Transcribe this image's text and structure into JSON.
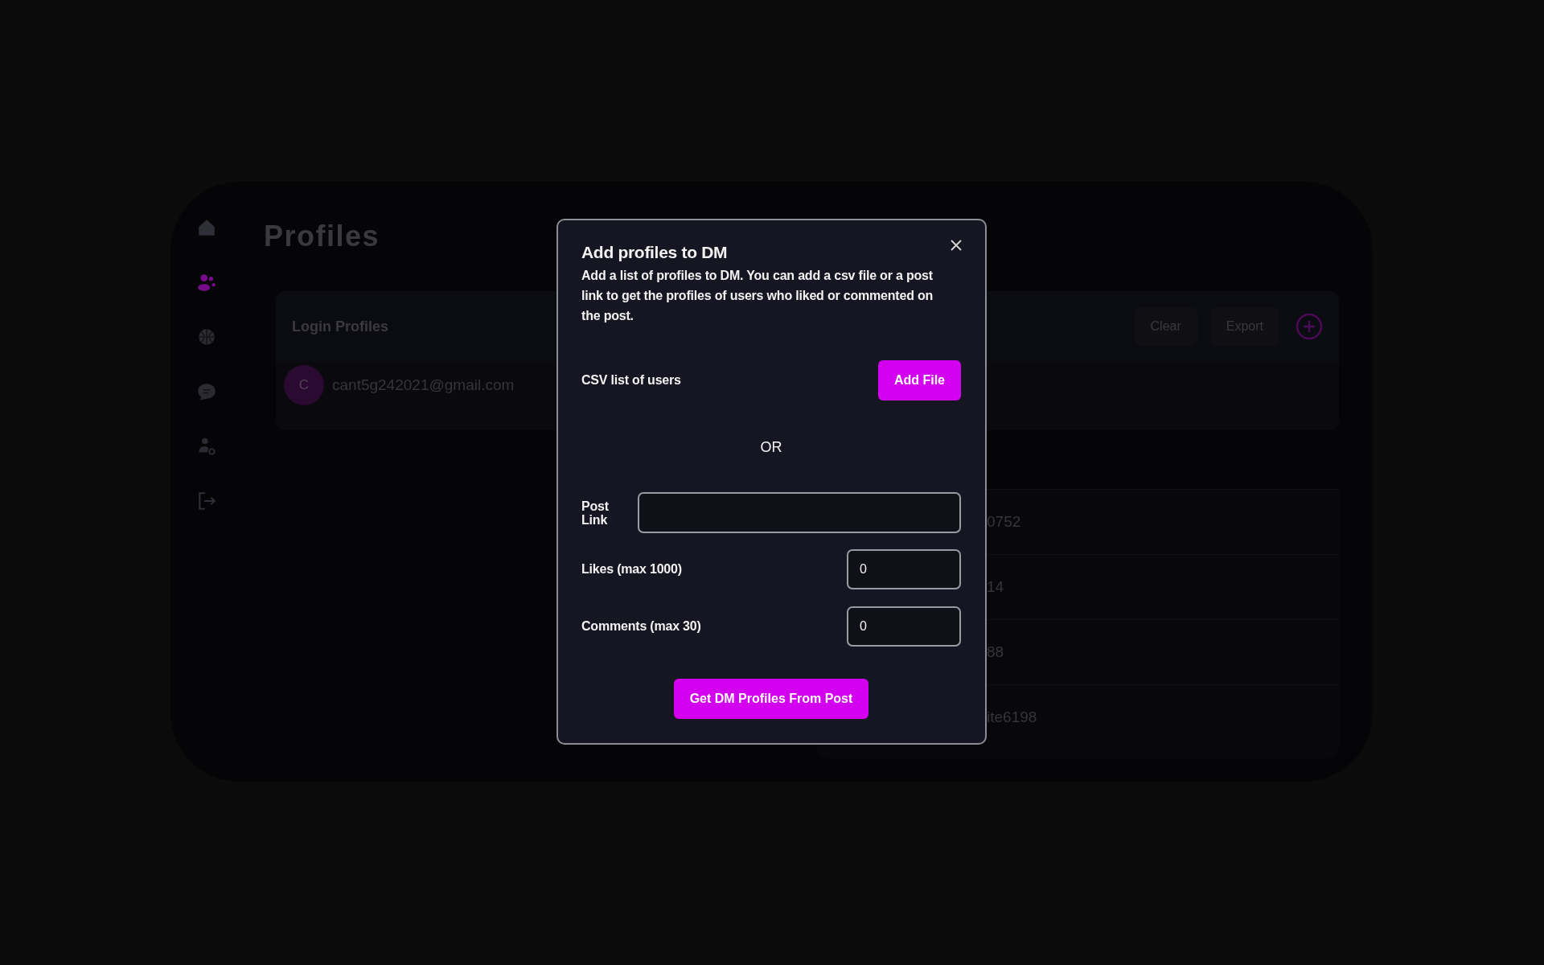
{
  "sidebar": {
    "items": [
      {
        "kind": "home",
        "selected": false
      },
      {
        "kind": "users",
        "selected": true
      },
      {
        "kind": "globe",
        "selected": false
      },
      {
        "kind": "chat",
        "selected": false
      },
      {
        "kind": "user-settings",
        "selected": false
      },
      {
        "kind": "logout",
        "selected": false
      }
    ]
  },
  "page_title": "Profiles",
  "login_card": {
    "title": "Login Profiles",
    "buttons": [
      "Clear",
      "Export"
    ],
    "profiles": [
      {
        "initial": "C",
        "email": "cant5g242021@gmail.com"
      }
    ]
  },
  "accounts_rows": [
    "0752",
    "14",
    "88",
    "ite6198"
  ],
  "modal": {
    "title": "Add profiles to DM",
    "description": "Add a list of profiles to DM. You can add a csv file or a post link to get the profiles of users who liked or commented on the post.",
    "csv_label": "CSV list of users",
    "add_file_button": "Add File",
    "separator": "OR",
    "fields": [
      {
        "kind": "wide",
        "label": "Post Link"
      },
      {
        "kind": "number",
        "label": "Likes (max 1000)",
        "value": "0"
      },
      {
        "kind": "number",
        "label": "Comments (max 30)",
        "value": "0"
      }
    ],
    "submit_button": "Get DM Profiles From Post"
  }
}
